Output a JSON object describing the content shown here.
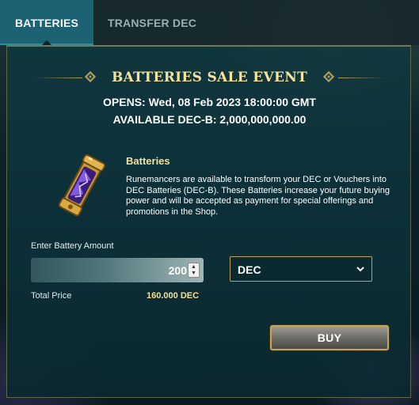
{
  "tabs": [
    {
      "label": "BATTERIES",
      "active": true
    },
    {
      "label": "TRANSFER DEC",
      "active": false
    }
  ],
  "event": {
    "title": "BATTERIES SALE EVENT",
    "opens": "OPENS: Wed, 08 Feb 2023 18:00:00 GMT",
    "available": "AVAILABLE DEC-B: 2,000,000,000.00"
  },
  "product": {
    "title": "Batteries",
    "icon": "battery-crystal-icon",
    "description": "Runemancers are available to transform your DEC or Vouchers into DEC Batteries (DEC-B). These Batteries increase your future buying power and will be accepted as payment for special offerings and promotions in the Shop."
  },
  "form": {
    "amount_label": "Enter Battery Amount",
    "amount_value": "200",
    "currency_value": "DEC",
    "total_label": "Total Price",
    "total_value": "160.000 DEC",
    "buy_label": "BUY"
  },
  "colors": {
    "accent_gold": "#c2a25a",
    "title_gold": "#f3e39e",
    "active_tab": "#1c6272",
    "panel_bg": "#10373e"
  }
}
